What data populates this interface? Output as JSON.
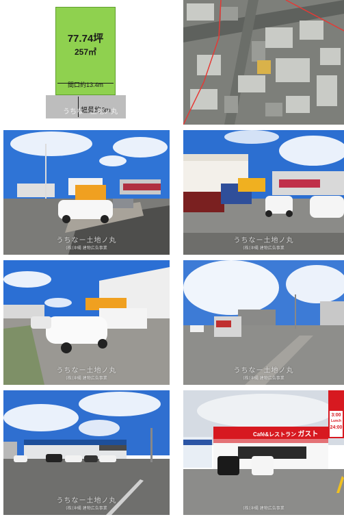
{
  "plot": {
    "area_tsubo": "77.74坪",
    "area_m2": "257㎡",
    "frontage": "間口約13.4m",
    "road_width": "幅員約6m"
  },
  "watermark": {
    "brand": "うちなー土地ノ丸",
    "sub": "(株)沖縄 建物広告事業"
  },
  "store_sign": {
    "cafe": "Café&レストラン",
    "name": "ガスト",
    "hours_top": "3:00",
    "hours_bottom": "24:00",
    "hours_note": "Lunch"
  },
  "colors": {
    "lot_green": "#8fd14f",
    "road_gray": "#bdbdbd",
    "boundary_red": "#e53935",
    "gusto_red": "#d71920"
  }
}
